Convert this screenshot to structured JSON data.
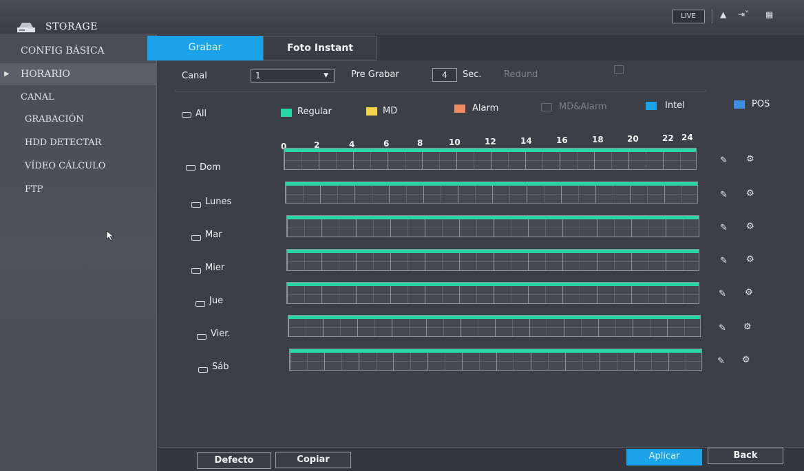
{
  "header": {
    "title": "STORAGE",
    "live_label": "LIVE"
  },
  "sidebar": {
    "items": [
      {
        "label": "CONFIG BÁSICA"
      },
      {
        "label": "HORARIO"
      },
      {
        "label": "CANAL"
      },
      {
        "label": "GRABACIÓN"
      },
      {
        "label": "HDD DETECTAR"
      },
      {
        "label": "VÍDEO CÁLCULO"
      },
      {
        "label": "FTP"
      }
    ],
    "active_index": 1
  },
  "tabs": [
    {
      "label": "Grabar"
    },
    {
      "label": "Foto Instant"
    }
  ],
  "controls": {
    "canal_label": "Canal",
    "canal_value": "1",
    "pregrabar_label": "Pre Grabar",
    "pregrabar_value": "4",
    "pregrabar_unit": "Sec.",
    "redund_label": "Redund"
  },
  "legend": {
    "all_label": "All",
    "items": [
      {
        "label": "Regular",
        "color": "#28d7a4"
      },
      {
        "label": "MD",
        "color": "#f4d54a"
      },
      {
        "label": "Alarm",
        "color": "#f08a62"
      },
      {
        "label": "MD&Alarm",
        "color": "#55585f"
      },
      {
        "label": "Intel",
        "color": "#1aa3e8"
      },
      {
        "label": "POS",
        "color": "#3f8ee8"
      }
    ]
  },
  "hours": [
    "0",
    "2",
    "4",
    "6",
    "8",
    "10",
    "12",
    "14",
    "16",
    "18",
    "20",
    "22",
    "24"
  ],
  "days": [
    {
      "label": "Dom"
    },
    {
      "label": "Lunes"
    },
    {
      "label": "Mar"
    },
    {
      "label": "Mier"
    },
    {
      "label": "Jue"
    },
    {
      "label": "Vier."
    },
    {
      "label": "Sáb"
    }
  ],
  "footer": {
    "defecto_label": "Defecto",
    "copiar_label": "Copiar",
    "aplicar_label": "Aplicar",
    "back_label": "Back"
  }
}
